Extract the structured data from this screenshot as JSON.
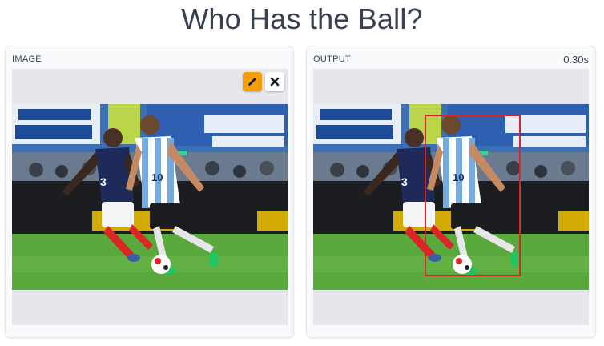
{
  "page": {
    "title": "Who Has the Ball?"
  },
  "input_panel": {
    "label": "IMAGE",
    "edit_icon": "pencil-icon",
    "clear_icon": "close-icon"
  },
  "output_panel": {
    "label": "OUTPUT",
    "time": "0.30s",
    "box_color": "#dc2626"
  },
  "colors": {
    "accent": "#f59e0b",
    "france_shirt": "#1e2a5a",
    "argentina_stripe": "#74acdf",
    "pitch": "#5aa93c",
    "socks_red": "#dc2626"
  }
}
